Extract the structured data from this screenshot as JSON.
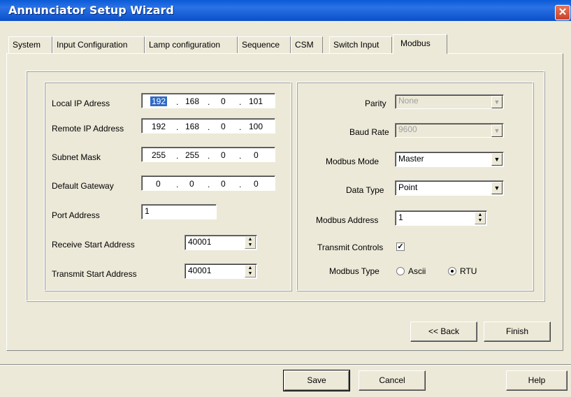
{
  "window": {
    "title": "Annunciator Setup Wizard",
    "close_glyph": "✕"
  },
  "tabs": [
    {
      "label": "System"
    },
    {
      "label": "Input Configuration"
    },
    {
      "label": "Lamp configuration"
    },
    {
      "label": "Sequence"
    },
    {
      "label": "CSM"
    },
    {
      "label": "Switch Input"
    },
    {
      "label": "Modbus",
      "active": true
    }
  ],
  "network": {
    "local_ip": {
      "label": "Local IP Adress",
      "octets": [
        "192",
        "168",
        "0",
        "101"
      ]
    },
    "remote_ip": {
      "label": "Remote IP Address",
      "octets": [
        "192",
        "168",
        "0",
        "100"
      ]
    },
    "subnet_mask": {
      "label": "Subnet Mask",
      "octets": [
        "255",
        "255",
        "0",
        "0"
      ]
    },
    "default_gateway": {
      "label": "Default Gateway",
      "octets": [
        "0",
        "0",
        "0",
        "0"
      ]
    },
    "port_address": {
      "label": "Port Address",
      "value": "1"
    },
    "receive_start": {
      "label": "Receive Start Address",
      "value": "40001"
    },
    "transmit_start": {
      "label": "Transmit Start Address",
      "value": "40001"
    }
  },
  "modbus": {
    "parity": {
      "label": "Parity",
      "value": "None",
      "enabled": false
    },
    "baud_rate": {
      "label": "Baud Rate",
      "value": "9600",
      "enabled": false
    },
    "mode": {
      "label": "Modbus Mode",
      "value": "Master"
    },
    "data_type": {
      "label": "Data Type",
      "value": "Point"
    },
    "address": {
      "label": "Modbus Address",
      "value": "1"
    },
    "transmit_controls": {
      "label": "Transmit Controls",
      "checked": true,
      "check_glyph": "✓"
    },
    "type": {
      "label": "Modbus Type",
      "options": [
        "Ascii",
        "RTU"
      ],
      "selected": "RTU"
    }
  },
  "wizard_buttons": {
    "back": "<< Back",
    "finish": "Finish"
  },
  "footer_buttons": {
    "save": "Save",
    "cancel": "Cancel",
    "help": "Help"
  },
  "glyphs": {
    "dropdown": "▼",
    "spin_up": "▲",
    "spin_down": "▼",
    "ip_dot": "."
  }
}
